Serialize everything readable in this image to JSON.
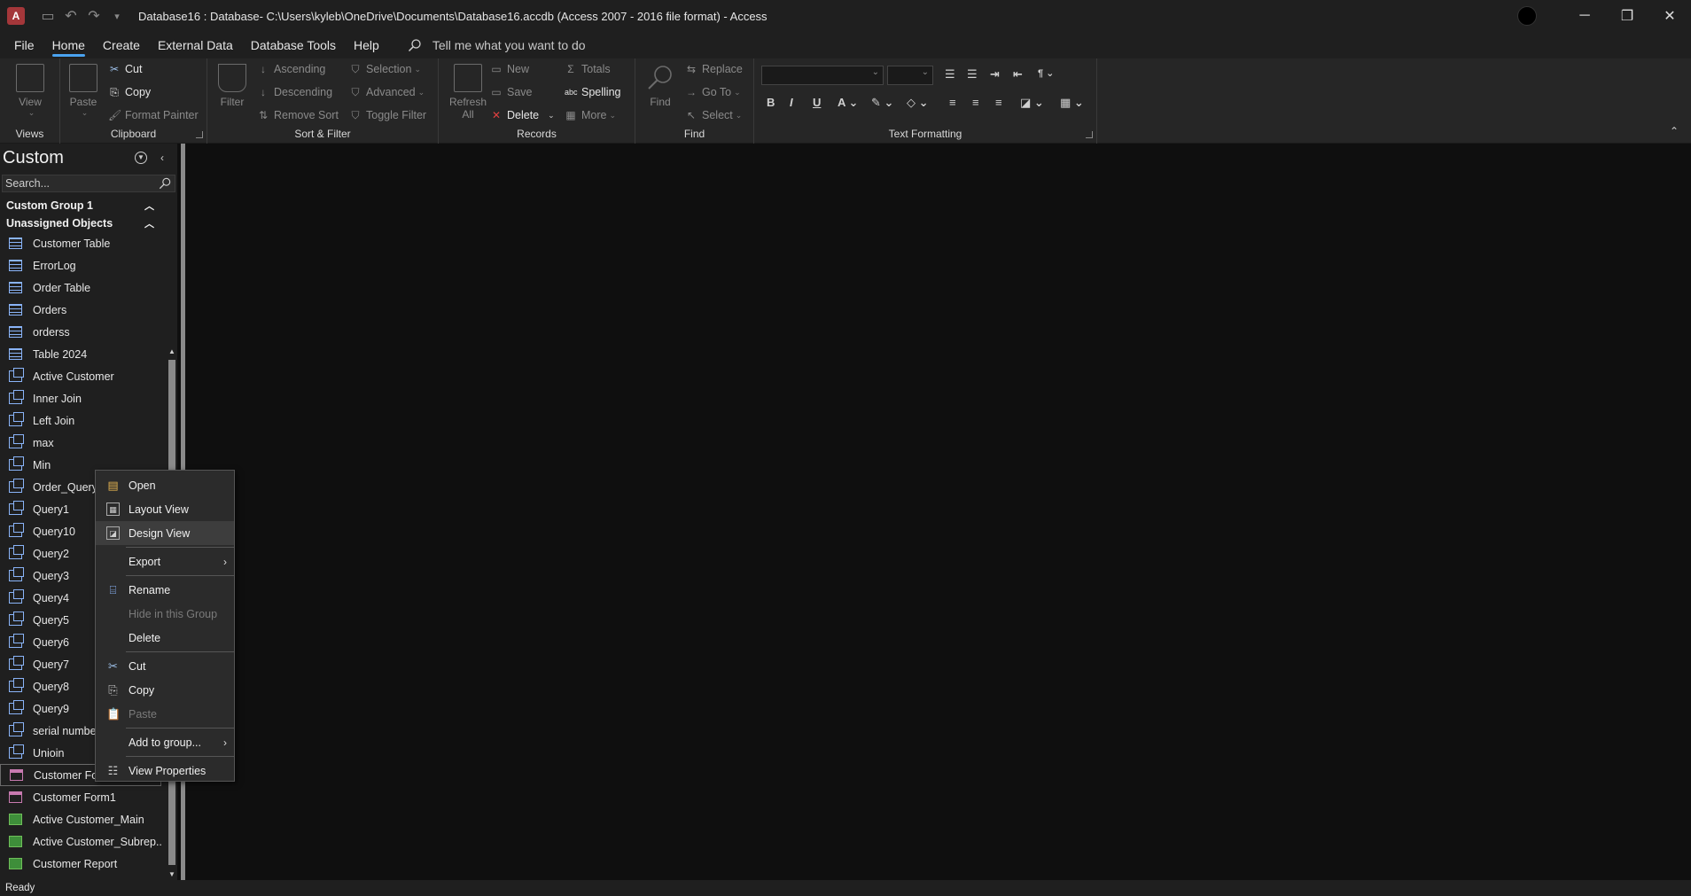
{
  "titlebar": {
    "app_icon": "access-logo",
    "title": "Database16 : Database- C:\\Users\\kyleb\\OneDrive\\Documents\\Database16.accdb (Access 2007 - 2016 file format)  -  Access"
  },
  "menu": {
    "tabs": [
      "File",
      "Home",
      "Create",
      "External Data",
      "Database Tools",
      "Help"
    ],
    "active": "Home",
    "tell_me": "Tell me what you want to do"
  },
  "ribbon": {
    "views": {
      "label": "Views",
      "view": "View"
    },
    "clipboard": {
      "label": "Clipboard",
      "paste": "Paste",
      "cut": "Cut",
      "copy": "Copy",
      "format_painter": "Format Painter"
    },
    "sort_filter": {
      "label": "Sort & Filter",
      "filter": "Filter",
      "ascending": "Ascending",
      "descending": "Descending",
      "remove_sort": "Remove Sort",
      "selection": "Selection",
      "advanced": "Advanced",
      "toggle_filter": "Toggle Filter"
    },
    "records": {
      "label": "Records",
      "refresh": "Refresh",
      "refresh_all": "All",
      "new": "New",
      "save": "Save",
      "delete": "Delete",
      "totals": "Totals",
      "spelling": "Spelling",
      "more": "More"
    },
    "find": {
      "label": "Find",
      "find": "Find",
      "replace": "Replace",
      "goto": "Go To",
      "select": "Select"
    },
    "text_formatting": {
      "label": "Text Formatting",
      "bold": "B",
      "italic": "I",
      "underline": "U"
    }
  },
  "nav": {
    "title": "Custom",
    "search_placeholder": "Search...",
    "groups": {
      "custom1": "Custom Group 1",
      "unassigned": "Unassigned Objects"
    },
    "items": [
      {
        "label": "Customer Table",
        "type": "table"
      },
      {
        "label": "ErrorLog",
        "type": "table"
      },
      {
        "label": "Order Table",
        "type": "table"
      },
      {
        "label": "Orders",
        "type": "table"
      },
      {
        "label": "orderss",
        "type": "table"
      },
      {
        "label": "Table 2024",
        "type": "table"
      },
      {
        "label": "Active Customer",
        "type": "query"
      },
      {
        "label": "Inner Join",
        "type": "query"
      },
      {
        "label": "Left Join",
        "type": "query"
      },
      {
        "label": "max",
        "type": "query"
      },
      {
        "label": "Min",
        "type": "query"
      },
      {
        "label": "Order_Query",
        "type": "query"
      },
      {
        "label": "Query1",
        "type": "query"
      },
      {
        "label": "Query10",
        "type": "query"
      },
      {
        "label": "Query2",
        "type": "query"
      },
      {
        "label": "Query3",
        "type": "query"
      },
      {
        "label": "Query4",
        "type": "query"
      },
      {
        "label": "Query5",
        "type": "query"
      },
      {
        "label": "Query6",
        "type": "query"
      },
      {
        "label": "Query7",
        "type": "query"
      },
      {
        "label": "Query8",
        "type": "query"
      },
      {
        "label": "Query9",
        "type": "query"
      },
      {
        "label": "serial numbe",
        "type": "query"
      },
      {
        "label": "Unioin",
        "type": "query"
      },
      {
        "label": "Customer Fo",
        "type": "form"
      },
      {
        "label": "Customer Form1",
        "type": "form"
      },
      {
        "label": "Active Customer_Main",
        "type": "report"
      },
      {
        "label": "Active Customer_Subrep...",
        "type": "report"
      },
      {
        "label": "Customer Report",
        "type": "report"
      }
    ]
  },
  "context_menu": {
    "open": "Open",
    "layout_view": "Layout View",
    "design_view": "Design View",
    "export": "Export",
    "rename": "Rename",
    "hide_in_group": "Hide in this Group",
    "delete": "Delete",
    "cut": "Cut",
    "copy": "Copy",
    "paste": "Paste",
    "add_to_group": "Add to group...",
    "view_properties": "View Properties"
  },
  "status": {
    "text": "Ready"
  },
  "colors": {
    "accent": "#4aa3f0",
    "background": "#0f0f0f",
    "chrome": "#1f1f1f",
    "ribbon": "#262626"
  }
}
